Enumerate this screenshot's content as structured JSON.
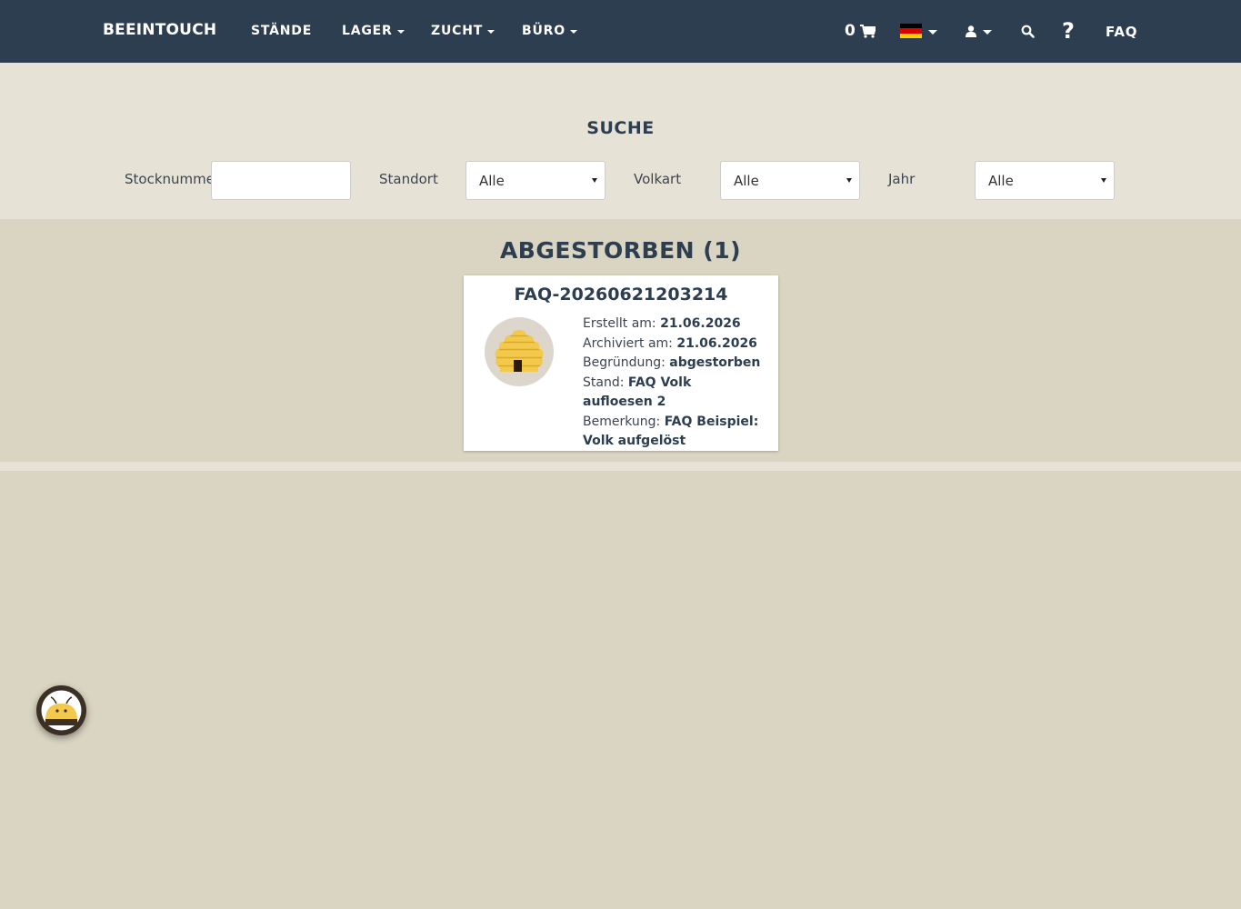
{
  "navbar": {
    "brand": "BEEINTOUCH",
    "items": [
      {
        "label": "STÄNDE",
        "dropdown": false
      },
      {
        "label": "LAGER",
        "dropdown": true
      },
      {
        "label": "ZUCHT",
        "dropdown": true
      },
      {
        "label": "BÜRO",
        "dropdown": true
      }
    ],
    "cart_count": "0",
    "faq_label": "FAQ",
    "icons": [
      "shopping-cart-icon",
      "german-flag-icon",
      "user-icon",
      "search-icon",
      "question-icon"
    ]
  },
  "search": {
    "title": "SUCHE",
    "stocknummer_label": "Stocknummer",
    "stocknummer_value": "",
    "standort_label": "Standort",
    "standort_value": "Alle",
    "volkart_label": "Volkart",
    "volkart_value": "Alle",
    "jahr_label": "Jahr",
    "jahr_value": "Alle"
  },
  "results": {
    "title": "ABGESTORBEN (1)",
    "card": {
      "title": "FAQ-20260621203214",
      "erstellt_label": "Erstellt am:",
      "erstellt_value": "21.06.2026",
      "archiviert_label": "Archiviert am:",
      "archiviert_value": "21.06.2026",
      "begruendung_label": "Begründung:",
      "begruendung_value": "abgestorben",
      "stand_label": "Stand:",
      "stand_value": "FAQ Volk aufloesen 2",
      "bemerkung_label": "Bemerkung:",
      "bemerkung_value": "FAQ Beispiel: Volk aufgelöst"
    }
  },
  "colors": {
    "navbar": "#2c3e50",
    "search_bg": "#e6e2d6",
    "page_bg": "#dad4c2",
    "accent_yellow": "#f2c94c"
  }
}
